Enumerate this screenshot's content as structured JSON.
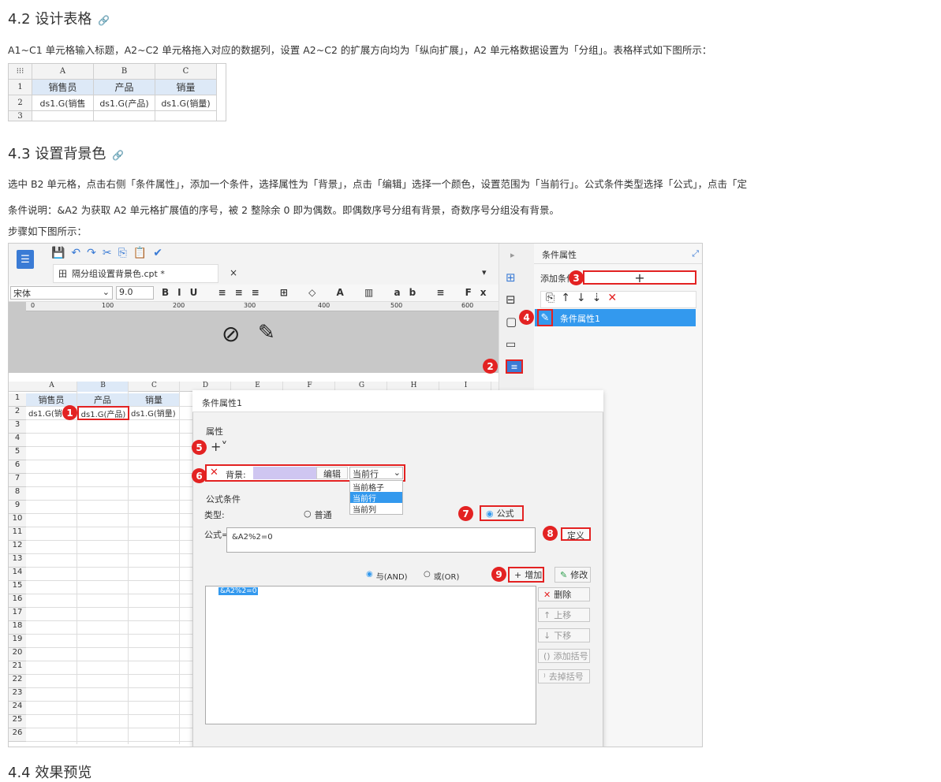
{
  "s42": {
    "title": "4.2 设计表格",
    "link": "🔗",
    "p1": "A1~C1 单元格输入标题，A2~C2 单元格拖入对应的数据列，设置 A2~C2 的扩展方向均为「纵向扩展」，A2 单元格数据设置为「分组」。表格样式如下图所示："
  },
  "mini": {
    "cols": [
      "A",
      "B",
      "C"
    ],
    "titles": [
      "销售员",
      "产品",
      "销量"
    ],
    "data": [
      "ds1.G(销售",
      "ds1.G(产品)",
      "ds1.G(销量)"
    ],
    "rows": [
      "1",
      "2",
      "3"
    ]
  },
  "s43": {
    "title": "4.3 设置背景色",
    "link": "🔗",
    "p1": "选中 B2 单元格，点击右侧「条件属性」，添加一个条件，选择属性为「背景」，点击「编辑」选择一个颜色，设置范围为「当前行」。公式条件类型选择「公式」，点击「定",
    "p2": "条件说明：&A2 为获取 A2 单元格扩展值的序号，被 2 整除余 0 即为偶数。即偶数序号分组有背景，奇数序号分组没有背景。",
    "p3": "步骤如下图所示："
  },
  "designer": {
    "tab": "隔分组设置背景色.cpt *",
    "font": "宋体",
    "size": "9.0",
    "ruler": [
      "0",
      "100",
      "200",
      "300",
      "400",
      "500",
      "600"
    ],
    "cols": [
      "A",
      "B",
      "C",
      "D",
      "E",
      "F",
      "G",
      "H",
      "I"
    ],
    "rows": [
      "1",
      "2",
      "3",
      "4",
      "5",
      "6",
      "7",
      "8",
      "9",
      "10",
      "11",
      "12",
      "13",
      "14",
      "15",
      "16",
      "17",
      "18",
      "19",
      "20",
      "21",
      "22",
      "23",
      "24",
      "25",
      "26"
    ],
    "row1": [
      "销售员",
      "产品",
      "销量"
    ],
    "row2": [
      "ds1.G(销",
      "ds1.G(产品)",
      "ds1.G(销量)"
    ],
    "panel_title": "条件属性",
    "add_label": "添加条件",
    "cond_item": "条件属性1",
    "dlg": {
      "title": "条件属性1",
      "attr": "属性",
      "bg": "背景:",
      "edit": "编辑",
      "scope": "当前行",
      "opts": [
        "当前格子",
        "当前行",
        "当前列"
      ],
      "fc": "公式条件",
      "type": "类型:",
      "normal": "普通",
      "formula": "公式",
      "flabel": "公式=",
      "fvalue": "&A2%2=0",
      "define": "定义",
      "and": "与(AND)",
      "or": "或(OR)",
      "add": "增加",
      "modify": "修改",
      "del": "删除",
      "up": "上移",
      "down": "下移",
      "addp": "添加括号",
      "rmp": "去掉括号",
      "listv": "&A2%2=0"
    },
    "badges": [
      "1",
      "2",
      "3",
      "4",
      "5",
      "6",
      "7",
      "8",
      "9"
    ]
  },
  "s44": {
    "title": "4.4 效果预览"
  },
  "colors": {
    "red": "#e32222",
    "blue": "#3399ee",
    "selblue": "#2f80d8"
  }
}
